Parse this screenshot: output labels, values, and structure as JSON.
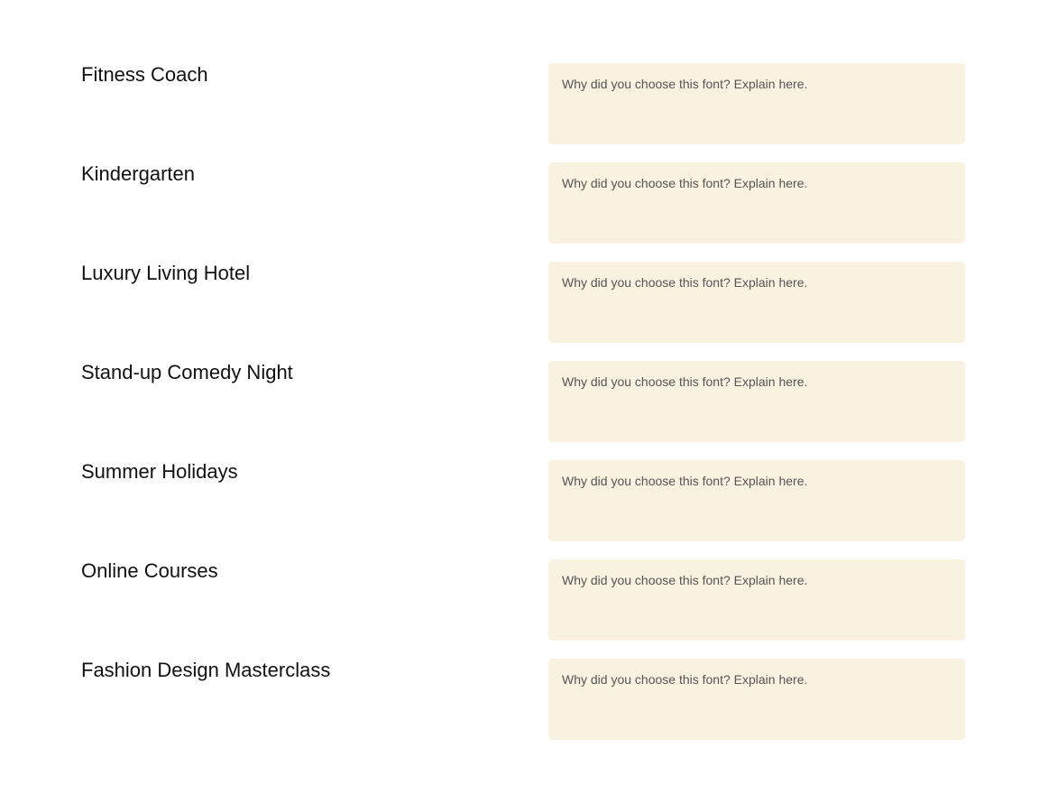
{
  "colors": {
    "field_background": "#faf2e1",
    "label_text": "#111111",
    "placeholder_text": "#555555"
  },
  "rows": [
    {
      "label": "Fitness Coach",
      "field": {
        "value": "",
        "placeholder": "Why did you choose this font? Explain here."
      }
    },
    {
      "label": "Kindergarten",
      "field": {
        "value": "",
        "placeholder": "Why did you choose this font? Explain here."
      }
    },
    {
      "label": "Luxury Living Hotel",
      "field": {
        "value": "",
        "placeholder": "Why did you choose this font? Explain here."
      }
    },
    {
      "label": "Stand-up Comedy Night",
      "field": {
        "value": "",
        "placeholder": "Why did you choose this font? Explain here."
      }
    },
    {
      "label": "Summer Holidays",
      "field": {
        "value": "",
        "placeholder": "Why did you choose this font? Explain here."
      }
    },
    {
      "label": "Online Courses",
      "field": {
        "value": "",
        "placeholder": "Why did you choose this font? Explain here."
      }
    },
    {
      "label": "Fashion Design Masterclass",
      "field": {
        "value": "",
        "placeholder": "Why did you choose this font? Explain here."
      }
    }
  ]
}
